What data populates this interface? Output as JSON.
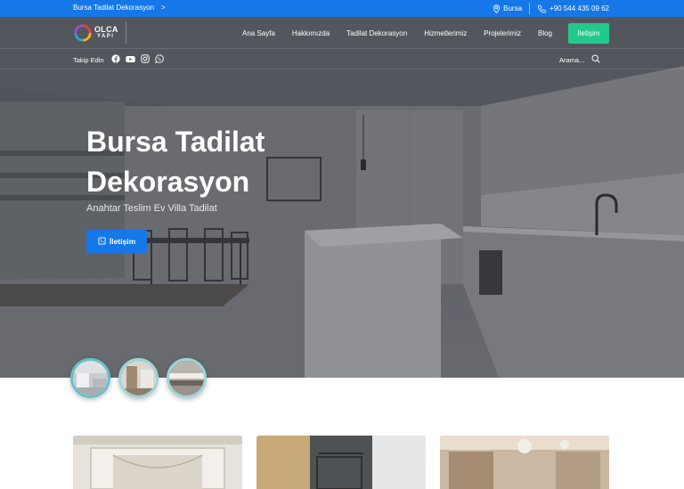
{
  "topbar": {
    "breadcrumb": "Bursa Tadilat Dekorasyon",
    "breadcrumb_arrow": ">",
    "location": "Bursa",
    "phone": "+90 544 435 09 62"
  },
  "logo": {
    "line1": "OLCA",
    "line2": "YAPI"
  },
  "nav": {
    "items": [
      "Ana Sayfa",
      "Hakkımızda",
      "Tadilat Dekorasyon",
      "Hizmetlerimiz",
      "Projelerimiz",
      "Blog"
    ],
    "contact_label": "İletişim"
  },
  "social": {
    "label": "Takip Edin",
    "icons": [
      "facebook-icon",
      "youtube-icon",
      "instagram-icon",
      "whatsapp-icon"
    ]
  },
  "search": {
    "label": "Arama..."
  },
  "hero": {
    "title": "Bursa Tadilat Dekorasyon",
    "subtitle": "Anahtar Teslim Ev Villa Tadilat",
    "button_label": "İletişim"
  },
  "colors": {
    "primary": "#1677e8",
    "accent": "#22c98b",
    "thumb_border": "#9fd4d9"
  }
}
